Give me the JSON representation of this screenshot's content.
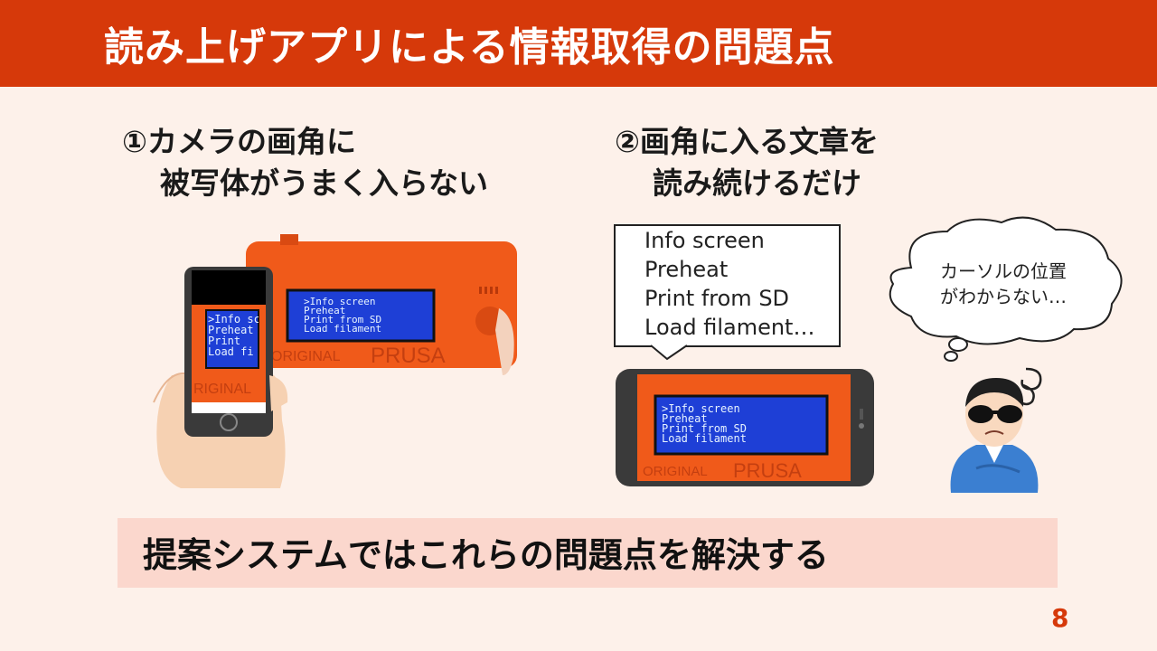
{
  "slide": {
    "title": "読み上げアプリによる情報取得の問題点",
    "page_number": "8"
  },
  "problems": [
    {
      "line1": "①カメラの画角に",
      "line2": "被写体がうまく入らない"
    },
    {
      "line1": "②画角に入る文章を",
      "line2": "読み続けるだけ"
    }
  ],
  "speech_bubble": {
    "lines": [
      "Info screen",
      "Preheat",
      "Print from SD",
      "Load filament…"
    ]
  },
  "thought_bubble": {
    "lines": [
      "カーソルの位置",
      "がわからない…"
    ]
  },
  "lcd": {
    "lines": [
      ">Info screen",
      " Preheat",
      " Print from SD",
      " Load filament"
    ],
    "brand_left": "ORIGINAL",
    "brand_right": "PRUSA"
  },
  "phone_lcd": {
    "lines": [
      ">Info sc",
      " Preheat",
      " Print",
      " Load fi"
    ],
    "brand": "RIGINAL"
  },
  "conclusion": "提案システムではこれらの問題点を解決する",
  "colors": {
    "accent": "#d6390a",
    "background": "#fdf1ea",
    "conclusion_bg": "#fbd7cd",
    "lcd_blue": "#1e3fd6",
    "printer_orange": "#f05a1a"
  }
}
